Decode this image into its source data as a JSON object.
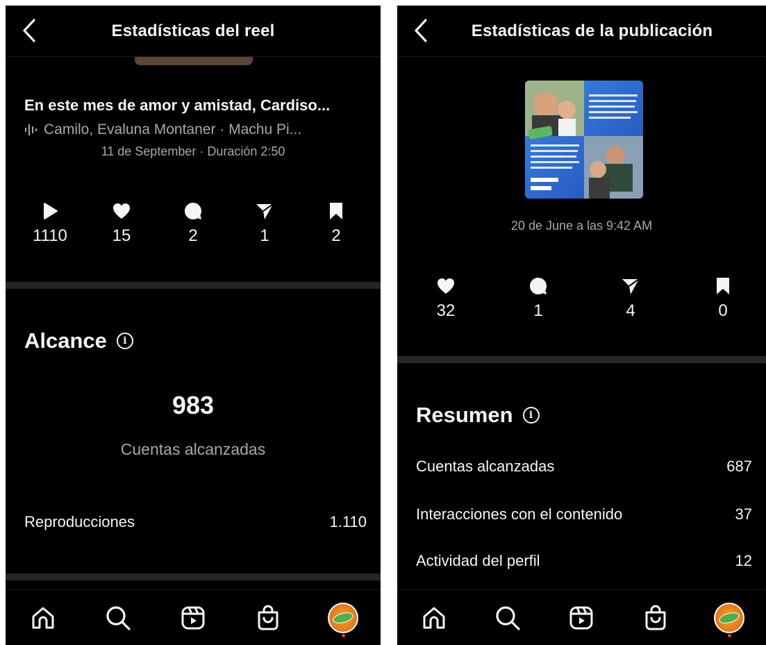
{
  "left": {
    "header_title": "Estadísticas del reel",
    "caption": "En este mes de amor y amistad, Cardiso...",
    "audio": "Camilo, Evaluna Montaner · Machu Pi...",
    "date_line": "11 de September · Duración 2:50",
    "stats": [
      {
        "icon": "play-icon",
        "value": "1110"
      },
      {
        "icon": "heart-icon",
        "value": "15"
      },
      {
        "icon": "comment-icon",
        "value": "2"
      },
      {
        "icon": "share-icon",
        "value": "1"
      },
      {
        "icon": "bookmark-icon",
        "value": "2"
      }
    ],
    "section_title": "Alcance",
    "reach_value": "983",
    "reach_label": "Cuentas alcanzadas",
    "rows": [
      {
        "label": "Reproducciones",
        "value": "1.110"
      }
    ]
  },
  "right": {
    "header_title": "Estadísticas de la publicación",
    "date_line": "20 de June a las 9:42 AM",
    "stats": [
      {
        "icon": "heart-icon",
        "value": "32"
      },
      {
        "icon": "comment-icon",
        "value": "1"
      },
      {
        "icon": "share-icon",
        "value": "4"
      },
      {
        "icon": "bookmark-icon",
        "value": "0"
      }
    ],
    "section_title": "Resumen",
    "rows": [
      {
        "label": "Cuentas alcanzadas",
        "value": "687"
      },
      {
        "label": "Interacciones con el contenido",
        "value": "37"
      },
      {
        "label": "Actividad del perfil",
        "value": "12"
      }
    ]
  },
  "nav": [
    "home-icon",
    "search-icon",
    "reels-icon",
    "shop-icon",
    "profile-avatar"
  ],
  "colors": {
    "background": "#000000",
    "text": "#f5f5f5",
    "muted": "#a8a8a8",
    "divider": "#262626",
    "notification_dot": "#ff3040"
  }
}
